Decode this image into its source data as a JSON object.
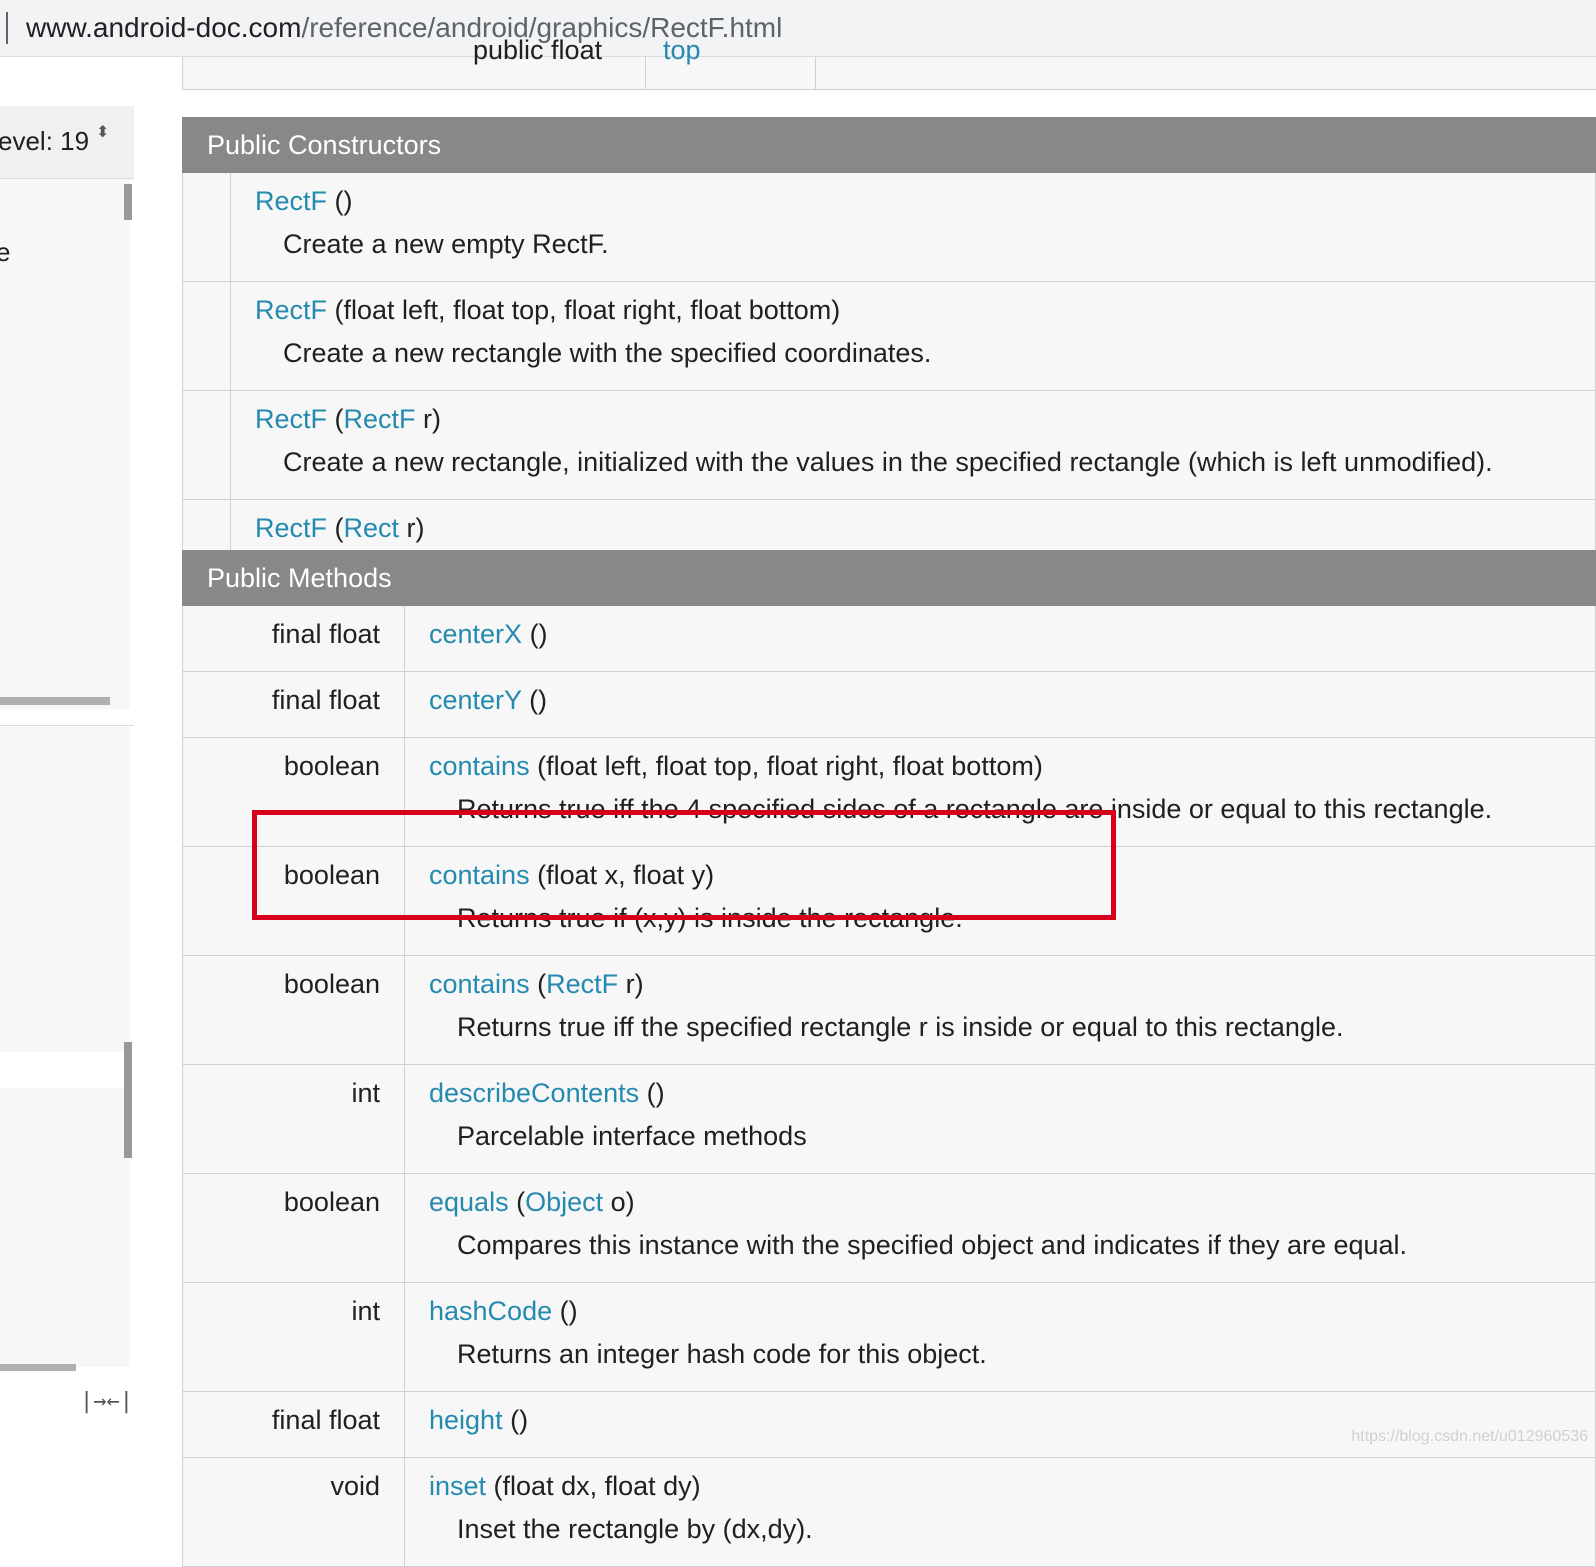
{
  "address_bar": {
    "host": "www.android-doc.com",
    "path": "/reference/android/graphics/RectF.html"
  },
  "sidebar": {
    "api_level_label": "evel: 19",
    "api_level_arrows": "⬍",
    "nav_fragment": "e",
    "sync_icon": "|→←|"
  },
  "fields_partial_row": {
    "type": "public float",
    "name": "top"
  },
  "constructors": {
    "title": "Public Constructors",
    "rows": [
      {
        "name": "RectF",
        "args_plain": " ()",
        "desc": "Create a new empty RectF."
      },
      {
        "name": "RectF",
        "args_plain": " (float left, float top, float right, float bottom)",
        "desc": "Create a new rectangle with the specified coordinates."
      },
      {
        "name": "RectF",
        "args_pre": " (",
        "arg_link": "RectF",
        "args_post": " r)",
        "desc": "Create a new rectangle, initialized with the values in the specified rectangle (which is left unmodified)."
      },
      {
        "name": "RectF",
        "args_pre": " (",
        "arg_link": "Rect",
        "args_post": " r)"
      }
    ]
  },
  "methods": {
    "title": "Public Methods",
    "rows": [
      {
        "type": "final float",
        "name": "centerX",
        "args_plain": " ()"
      },
      {
        "type": "final float",
        "name": "centerY",
        "args_plain": " ()"
      },
      {
        "type": "boolean",
        "name": "contains",
        "args_plain": " (float left, float top, float right, float bottom)",
        "desc": "Returns true iff the 4 specified sides of a rectangle are inside or equal to this rectangle."
      },
      {
        "type": "boolean",
        "name": "contains",
        "args_plain": " (float x, float y)",
        "desc": "Returns true if (x,y) is inside the rectangle."
      },
      {
        "type": "boolean",
        "name": "contains",
        "args_pre": " (",
        "arg_link": "RectF",
        "args_post": " r)",
        "desc": "Returns true iff the specified rectangle r is inside or equal to this rectangle."
      },
      {
        "type": "int",
        "name": "describeContents",
        "args_plain": " ()",
        "desc": "Parcelable interface methods"
      },
      {
        "type": "boolean",
        "name": "equals",
        "args_pre": " (",
        "arg_link": "Object",
        "args_post": " o)",
        "desc": "Compares this instance with the specified object and indicates if they are equal."
      },
      {
        "type": "int",
        "name": "hashCode",
        "args_plain": " ()",
        "desc": "Returns an integer hash code for this object."
      },
      {
        "type": "final float",
        "name": "height",
        "args_plain": " ()"
      },
      {
        "type": "void",
        "name": "inset",
        "args_plain": " (float dx, float dy)",
        "desc": "Inset the rectangle by (dx,dy)."
      }
    ]
  },
  "annotation": {
    "color": "#d6001c"
  },
  "watermark": "https://blog.csdn.net/u012960536",
  "colors": {
    "link": "#258aaf",
    "header_bg": "#888888",
    "row_bg": "#f7f7f7"
  }
}
